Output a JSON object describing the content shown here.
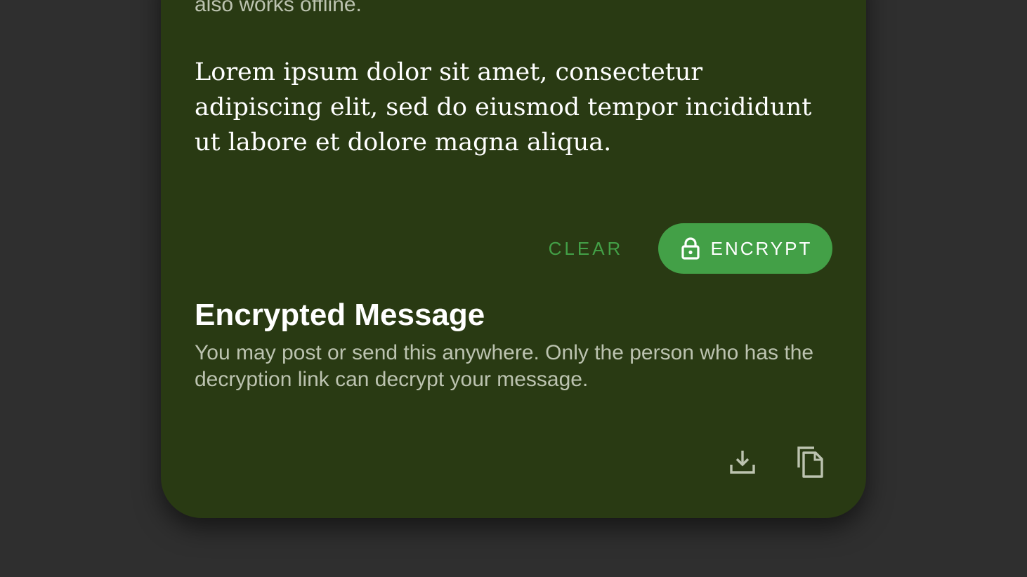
{
  "intro": {
    "text": "also works offline."
  },
  "message": {
    "text": "Lorem ipsum dolor sit amet, consectetur adipiscing elit, sed do eiusmod tempor incididunt ut labore et dolore magna aliqua."
  },
  "actions": {
    "clear_label": "CLEAR",
    "encrypt_label": "ENCRYPT",
    "encrypt_icon": "lock-icon"
  },
  "encrypted_section": {
    "title": "Encrypted Message",
    "description": "You may post or send this anywhere. Only the person who has the decryption link can decrypt your message.",
    "download_icon": "download-icon",
    "copy_icon": "copy-icon"
  },
  "colors": {
    "page_background": "#2f2f2f",
    "card_background": "#293a13",
    "accent": "#43a047",
    "secondary_text": "#bcc3b0",
    "primary_text": "#ffffff"
  }
}
